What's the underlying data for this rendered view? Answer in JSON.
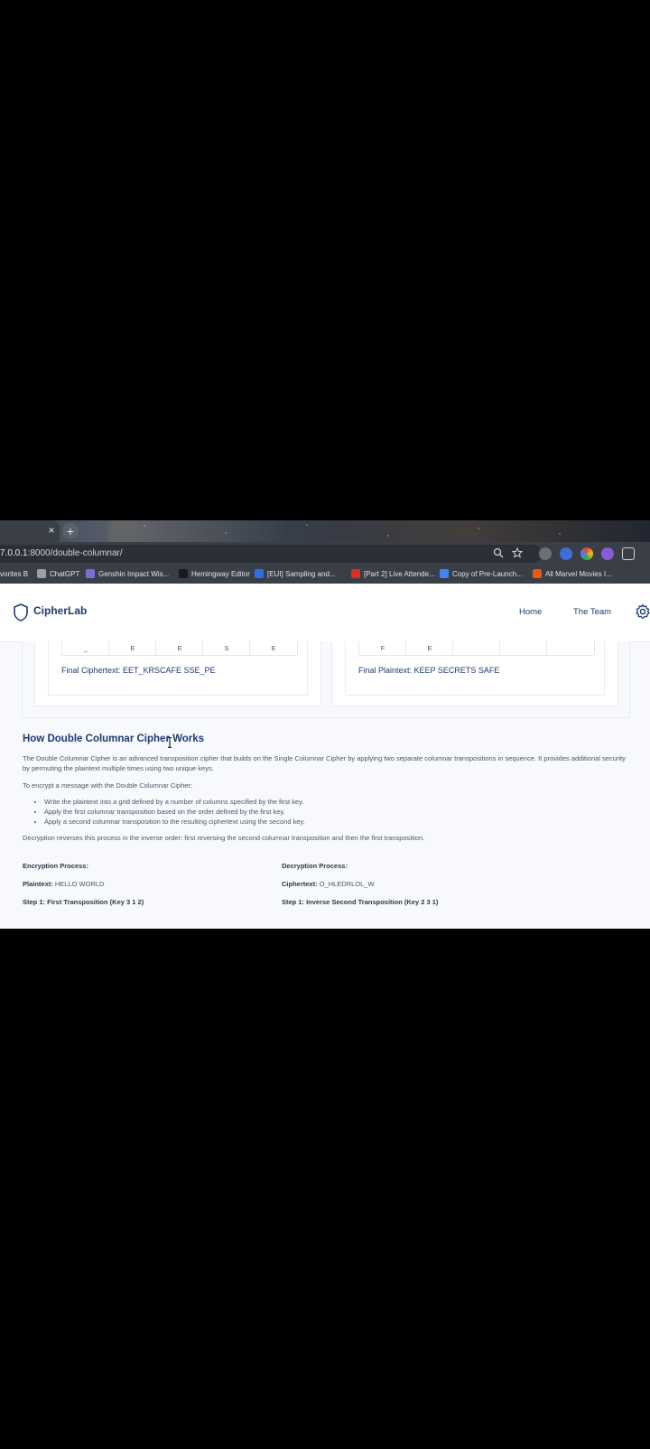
{
  "browser": {
    "tab_close_glyph": "×",
    "new_tab_glyph": "+",
    "url_host": "7.0.0.1",
    "url_rest": ":8000/double-columnar/",
    "bookmarks": [
      {
        "label": "vorites B",
        "color": ""
      },
      {
        "label": "ChatGPT",
        "color": "#9aa0a6"
      },
      {
        "label": "Genshin Impact Wis...",
        "color": "#7a6fd0"
      },
      {
        "label": "Hemingway Editor",
        "color": "#1a1a1a"
      },
      {
        "label": "[EUI] Sampling and...",
        "color": "#2f6fe0"
      },
      {
        "label": "[Part 2] Live Attende...",
        "color": "#d93025"
      },
      {
        "label": "Copy of Pre-Launch...",
        "color": "#4285f4"
      },
      {
        "label": "All Marvel Movies I...",
        "color": "#e8590c"
      }
    ]
  },
  "app": {
    "brand": "CipherLab",
    "nav": {
      "home": "Home",
      "team": "The Team"
    },
    "accent": "#1e3a6e"
  },
  "encrypt_panel": {
    "grid_row": [
      "_",
      "E",
      "E",
      "S",
      "E"
    ],
    "final_label": "Final Ciphertext: EET_KRSCAFE SSE_PE"
  },
  "decrypt_panel": {
    "grid_row": [
      "F",
      "E",
      "",
      "",
      ""
    ],
    "final_label": "Final Plaintext: KEEP SECRETS SAFE"
  },
  "info": {
    "title": "How Double Columnar Cipher Works",
    "intro": "The Double Columnar Cipher is an advanced transposition cipher that builds on the Single Columnar Cipher by applying two separate columnar transpositions in sequence. It provides additional security by permuting the plaintext multiple times using two unique keys.",
    "to_encrypt": "To encrypt a message with the Double Columnar Cipher:",
    "steps": [
      "Write the plaintext into a grid defined by a number of columns specified by the first key.",
      "Apply the first columnar transposition based on the order defined by the first key.",
      "Apply a second columnar transposition to the resulting ciphertext using the second key."
    ],
    "decrypt_note": "Decryption reverses this process in the inverse order: first reversing the second columnar transposition and then the first transposition.",
    "enc_heading": "Encryption Process:",
    "enc_plain_label": "Plaintext:",
    "enc_plain_value": "HELLO WORLD",
    "enc_step1": "Step 1: First Transposition (Key 3 1 2)",
    "dec_heading": "Decryption Process:",
    "dec_cipher_label": "Ciphertext:",
    "dec_cipher_value": "O_HLEDRLOL_W",
    "dec_step1": "Step 1: Inverse Second Transposition (Key 2 3 1)"
  }
}
